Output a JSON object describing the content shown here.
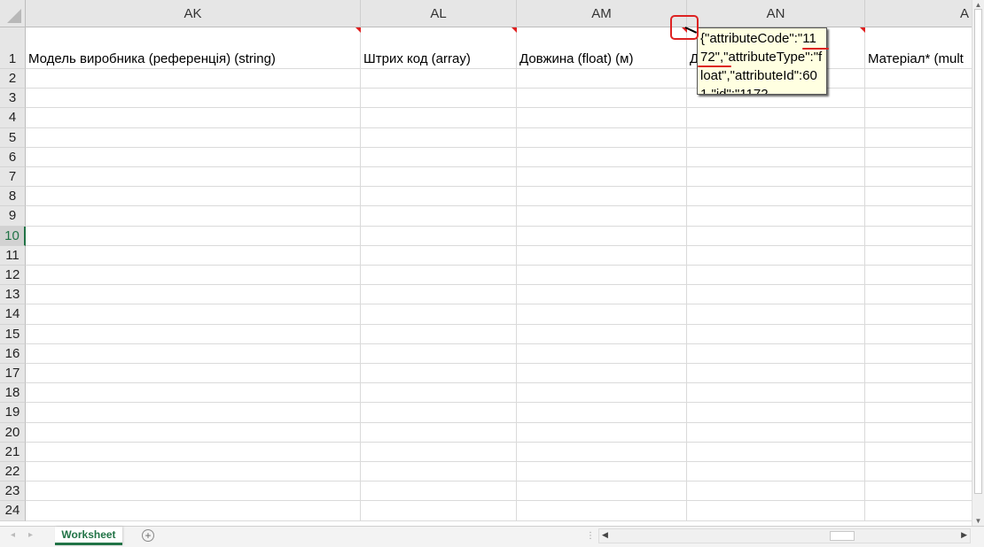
{
  "columns": [
    "AK",
    "AL",
    "AM",
    "AN",
    "A"
  ],
  "header_row": {
    "AK": "Модель виробника (референція) (string)",
    "AL": "Штрих код (array)",
    "AM": "Довжина (float) (м)",
    "AN": "Д",
    "AO": "Матеріал* (mult"
  },
  "row_numbers": [
    "1",
    "2",
    "3",
    "4",
    "5",
    "6",
    "7",
    "8",
    "9",
    "10",
    "11",
    "12",
    "13",
    "14",
    "15",
    "16",
    "17",
    "18",
    "19",
    "20",
    "21",
    "22",
    "23",
    "24"
  ],
  "active_row": "10",
  "comment_tooltip": {
    "text": "{\"attributeCode\":\"1172\",\"attributeType\":\"float\",\"attributeId\":601,\"id\":\"1172"
  },
  "sheet_tabs": [
    {
      "label": "Worksheet",
      "active": true
    }
  ],
  "icons": {
    "add_sheet": "plus-circle-icon",
    "scroll_left": "arrow-left-icon",
    "scroll_right": "arrow-right-icon",
    "scroll_up": "arrow-up-icon",
    "scroll_down": "arrow-down-icon"
  },
  "colors": {
    "accent": "#217346",
    "comment_indicator": "#e02020",
    "annotation": "#dd2222",
    "tooltip_bg": "#ffffe1"
  }
}
